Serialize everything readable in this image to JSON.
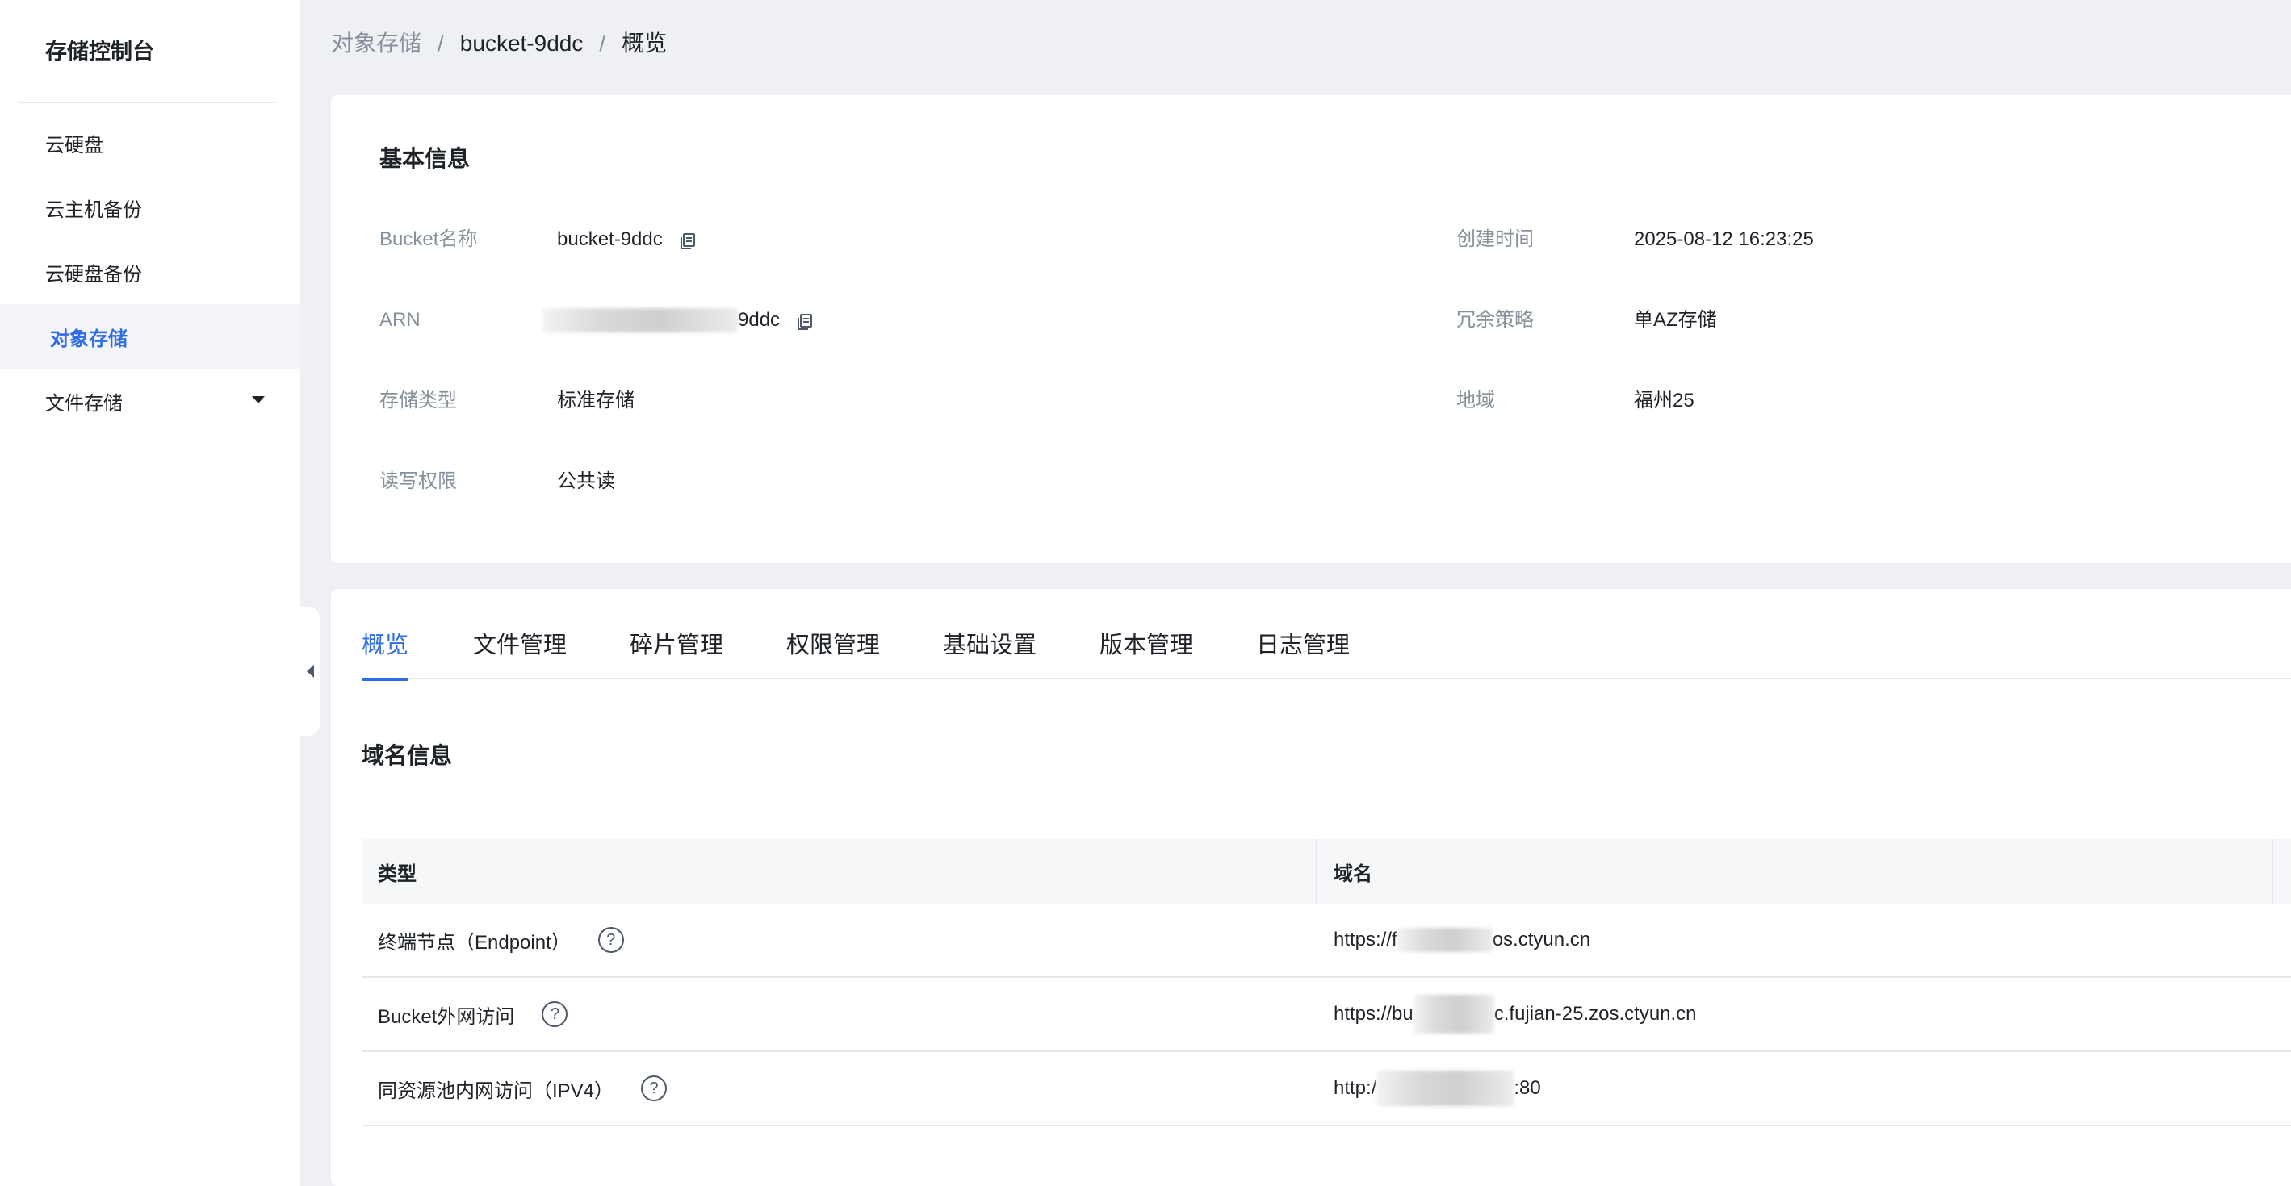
{
  "sidebar": {
    "title": "存储控制台",
    "items": [
      {
        "label": "云硬盘"
      },
      {
        "label": "云主机备份"
      },
      {
        "label": "云硬盘备份"
      },
      {
        "label": "对象存储"
      },
      {
        "label": "文件存储"
      }
    ],
    "active": "对象存储"
  },
  "breadcrumb": {
    "root": "对象存储",
    "bucket": "bucket-9ddc",
    "current": "概览",
    "separator": "/"
  },
  "basic_info": {
    "title": "基本信息",
    "bucket_name_label": "Bucket名称",
    "bucket_name_value": "bucket-9ddc",
    "arn_label": "ARN",
    "arn_value_suffix": "9ddc",
    "storage_type_label": "存储类型",
    "storage_type_value": "标准存储",
    "access_label": "读写权限",
    "access_value": "公共读",
    "created_label": "创建时间",
    "created_value": "2025-08-12 16:23:25",
    "redundancy_label": "冗余策略",
    "redundancy_value": "单AZ存储",
    "region_label": "地域",
    "region_value": "福州25"
  },
  "tabs": [
    {
      "label": "概览"
    },
    {
      "label": "文件管理"
    },
    {
      "label": "碎片管理"
    },
    {
      "label": "权限管理"
    },
    {
      "label": "基础设置"
    },
    {
      "label": "版本管理"
    },
    {
      "label": "日志管理"
    }
  ],
  "domain_info": {
    "title": "域名信息",
    "columns": [
      "类型",
      "域名"
    ],
    "rows": [
      {
        "type": "终端节点（Endpoint）",
        "domain_prefix": "https://f",
        "domain_suffix": "os.ctyun.cn"
      },
      {
        "type": "Bucket外网访问",
        "domain_prefix": "https://bu",
        "domain_suffix": "c.fujian-25.zos.ctyun.cn"
      },
      {
        "type": "同资源池内网访问（IPV4）",
        "domain_prefix": "http:/",
        "domain_suffix": ":80"
      }
    ]
  },
  "colors": {
    "accent": "#2e6be6",
    "label": "#86909c",
    "text": "#1f2329",
    "page_bg": "#eff0f3"
  }
}
